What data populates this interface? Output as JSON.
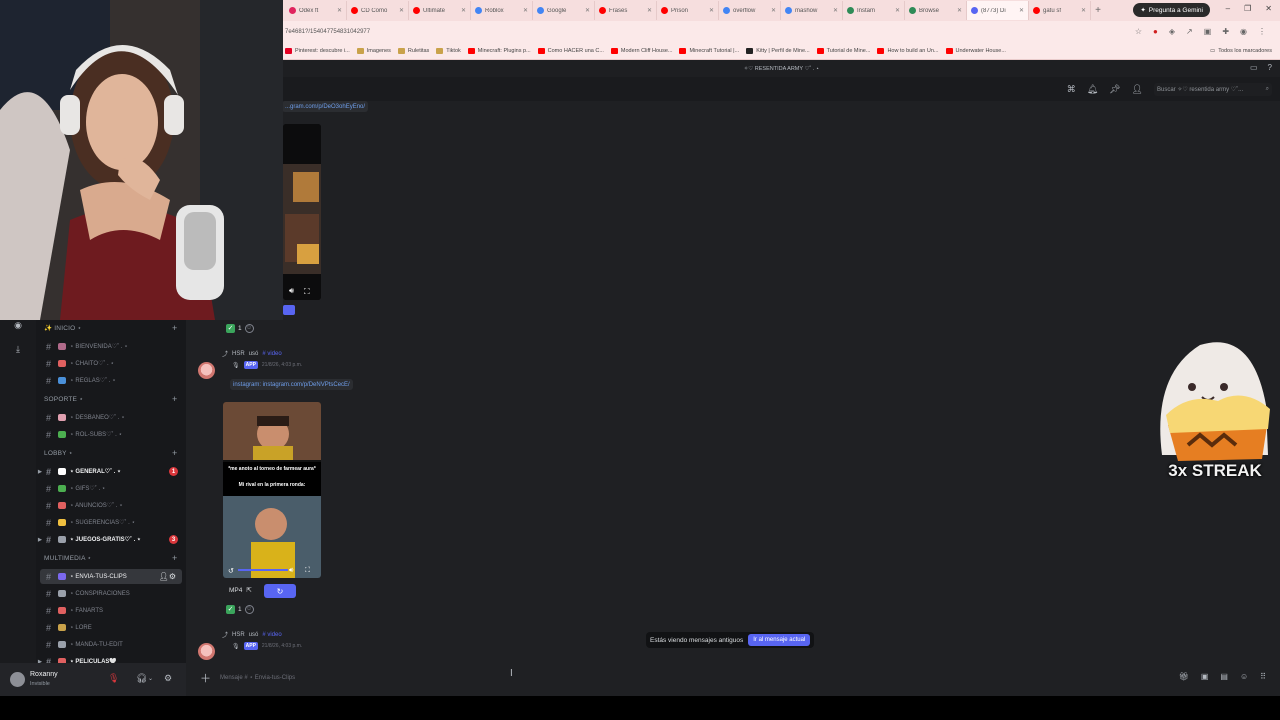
{
  "browser": {
    "tabs": [
      {
        "label": "Odex ft",
        "color": "#e0245e"
      },
      {
        "label": "CD Como",
        "color": "#ff0000"
      },
      {
        "label": "Ultimate",
        "color": "#ff0000"
      },
      {
        "label": "Roblox",
        "color": "#4285f4"
      },
      {
        "label": "Google",
        "color": "#4285f4"
      },
      {
        "label": "Frases",
        "color": "#ff0000"
      },
      {
        "label": "Prison",
        "color": "#ff0000"
      },
      {
        "label": "overflow",
        "color": "#4285f4"
      },
      {
        "label": "mashow",
        "color": "#4285f4"
      },
      {
        "label": "Instam",
        "color": "#2e8b57"
      },
      {
        "label": "Browse",
        "color": "#2e8b57"
      },
      {
        "label": "(8773) Di",
        "color": "#5865f2"
      },
      {
        "label": "gatu sf",
        "color": "#ff0000"
      }
    ],
    "gemini_label": "Pregunta a Gemini",
    "url": "7e4681?/154047754831042977",
    "bookmarks": [
      {
        "label": "Pinterest: descubre i...",
        "color": "#e60023"
      },
      {
        "label": "Imagenes",
        "color": "#c9a24a"
      },
      {
        "label": "Ruletitas",
        "color": "#c9a24a"
      },
      {
        "label": "Tiktok",
        "color": "#c9a24a"
      },
      {
        "label": "Minecraft: Plugins p...",
        "color": "#ff0000"
      },
      {
        "label": "Como HACER una C...",
        "color": "#ff0000"
      },
      {
        "label": "Modern Cliff House...",
        "color": "#ff0000"
      },
      {
        "label": "Minecraft Tutorial |...",
        "color": "#ff0000"
      },
      {
        "label": "Kitty | Perfil de Mine...",
        "color": "#222222"
      },
      {
        "label": "Tutorial de Mine...",
        "color": "#ff0000"
      },
      {
        "label": "How to build an Un...",
        "color": "#ff0000"
      },
      {
        "label": "Underwater House...",
        "color": "#ff0000"
      }
    ],
    "all_bookmarks": "Todos los marcadores"
  },
  "discord": {
    "window_title": "✧♡ RESENTIDA ARMY ♡˚ . ⋆",
    "search_placeholder": "Buscar ✧♡ resentida army ♡˚...",
    "categories": [
      {
        "label": "✨ INICIO ⋆",
        "channels": [
          {
            "label": "⋆ BIENVENIDA♡˚ . ⋆",
            "emoji": "#b06a8a",
            "bold": false
          },
          {
            "label": "⋆ CHAITO♡˚ . ⋆",
            "emoji": "#e06060",
            "bold": false
          },
          {
            "label": "⋆ REGLAS♡˚ . ⋆",
            "emoji": "#4a90d9",
            "bold": false
          }
        ]
      },
      {
        "label": "SOPORTE ⋆",
        "channels": [
          {
            "label": "⋆ DESBANEO♡˚ . ⋆",
            "emoji": "#e0a0b0",
            "bold": false
          },
          {
            "label": "⋆ ROL-SUBS♡˚ . ⋆",
            "emoji": "#4caf50",
            "bold": false
          }
        ]
      },
      {
        "label": "LOBBY ⋆",
        "channels": [
          {
            "label": "⋆ GENERAL♡˚ . ⋆",
            "emoji": "#ffffff",
            "bold": true,
            "badge": "1"
          },
          {
            "label": "⋆ GIFS♡˚ . ⋆",
            "emoji": "#4caf50",
            "bold": false
          },
          {
            "label": "⋆ ANUNCIOS♡˚ . ⋆",
            "emoji": "#e06060",
            "bold": false
          },
          {
            "label": "⋆ SUGERENCIAS♡˚ . ⋆",
            "emoji": "#f0c040",
            "bold": false
          },
          {
            "label": "⋆ JUEGOS-GRATIS♡˚ . ⋆",
            "emoji": "#9aa0aa",
            "bold": true,
            "badge": "3"
          }
        ]
      },
      {
        "label": "MULTIMEDIA ⋆",
        "channels": [
          {
            "label": "⋆ ENVIA-TUS-CLIPS",
            "emoji": "#7b68ee",
            "bold": false,
            "selected": true
          },
          {
            "label": "⋆ CONSPIRACIONES",
            "emoji": "#9aa0aa",
            "bold": false
          },
          {
            "label": "⋆ FANARTS",
            "emoji": "#e06060",
            "bold": false
          },
          {
            "label": "⋆ LORE",
            "emoji": "#c9a24a",
            "bold": false
          },
          {
            "label": "⋆ MANDA-TU-EDIT",
            "emoji": "#9aa0aa",
            "bold": false
          },
          {
            "label": "⋆ PELICULAS🤍",
            "emoji": "#e06060",
            "bold": true
          }
        ]
      }
    ],
    "user": {
      "name": "Roxanny",
      "status": "Invisible"
    },
    "messages": [
      {
        "link": "...gram.com/p/DeO3ohEyEno/"
      },
      {
        "author": "HSR",
        "action": "usó",
        "command": "# video",
        "app_tag": "APP",
        "timestamp": "21/8/26, 4:03 p.m.",
        "link": "instagram: instagram.com/p/DeNVPtsCecE/",
        "video_caption_1": "*me anoto al torneo de farmear aura*",
        "video_caption_2": "Mi rival en la primera ronda:",
        "format": "MP4",
        "reaction_count": "1"
      },
      {
        "author": "HSR",
        "action": "usó",
        "command": "# video",
        "app_tag": "APP",
        "timestamp": "21/8/26, 4:03 p.m."
      }
    ],
    "reaction_count_top": "1",
    "old_messages_notice": "Estás viendo mensajes antiguos",
    "jump_button": "Ir al mensaje actual",
    "composer_placeholder": "Mensaje # ⋆ Envia-tus-Clips"
  },
  "overlay": {
    "streak_text": "3x STREAK"
  }
}
